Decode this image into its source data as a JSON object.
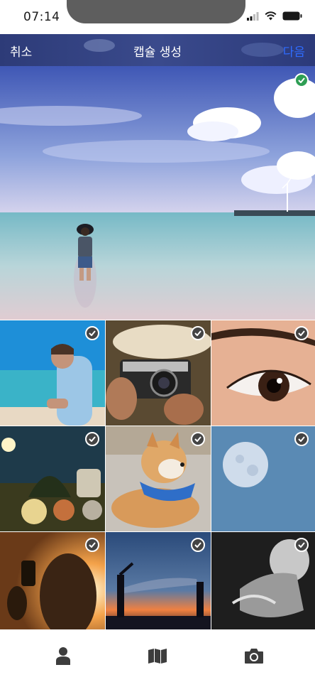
{
  "status": {
    "time": "07:14"
  },
  "header": {
    "cancel_label": "취소",
    "title": "캡슐 생성",
    "next_label": "다음"
  },
  "photos": [
    {
      "id": "beach",
      "selected": true
    },
    {
      "id": "boy-on-phone",
      "selected": true
    },
    {
      "id": "camera-hands",
      "selected": true
    },
    {
      "id": "eye",
      "selected": true
    },
    {
      "id": "moon-field",
      "selected": true
    },
    {
      "id": "shiba",
      "selected": true
    },
    {
      "id": "moon-sky",
      "selected": true
    },
    {
      "id": "sunset-phone",
      "selected": true
    },
    {
      "id": "couple-beach",
      "selected": true
    },
    {
      "id": "bw-face",
      "selected": true
    }
  ],
  "bottom_nav": {
    "items": [
      "profile-icon",
      "map-icon",
      "camera-icon"
    ]
  },
  "colors": {
    "header": "#34438a",
    "accent": "#2f6cff",
    "check_selected_hero": "#2e9e54"
  }
}
